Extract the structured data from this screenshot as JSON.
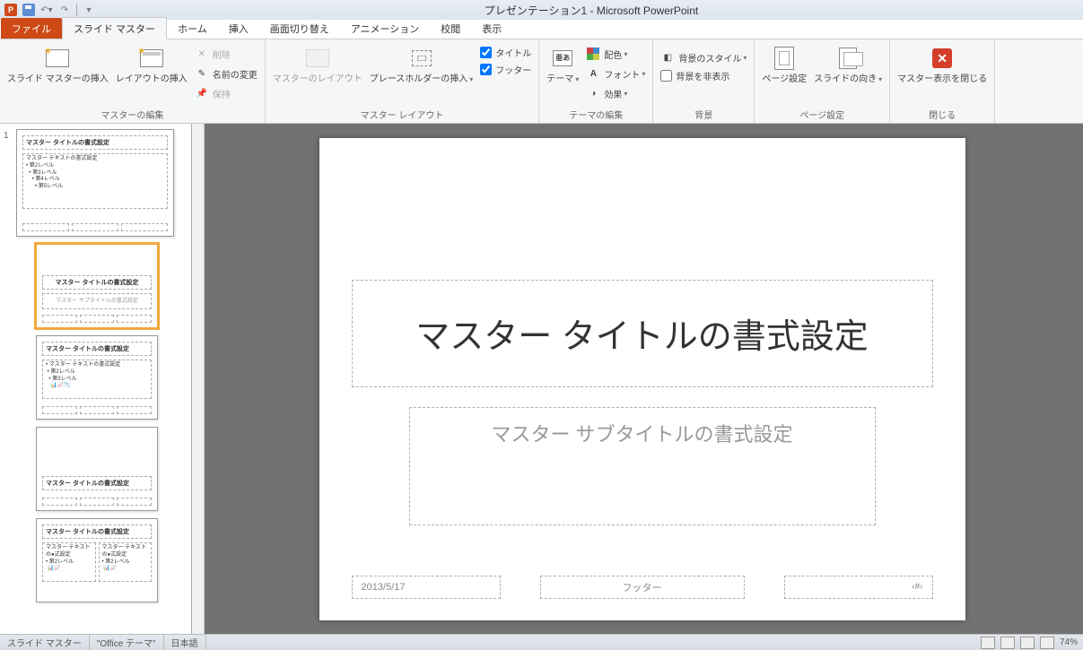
{
  "app": {
    "title": "プレゼンテーション1 - Microsoft PowerPoint"
  },
  "tabs": {
    "file": "ファイル",
    "items": [
      "スライド マスター",
      "ホーム",
      "挿入",
      "画面切り替え",
      "アニメーション",
      "校閲",
      "表示"
    ],
    "active_index": 0
  },
  "ribbon": {
    "group_edit_master": {
      "label": "マスターの編集",
      "insert_slide_master": "スライド マスターの挿入",
      "insert_layout": "レイアウトの挿入",
      "delete": "削除",
      "rename": "名前の変更",
      "preserve": "保持"
    },
    "group_master_layout": {
      "label": "マスター レイアウト",
      "master_layout": "マスターのレイアウト",
      "insert_placeholder": "プレースホルダーの挿入",
      "chk_title": "タイトル",
      "chk_footer": "フッター"
    },
    "group_theme": {
      "label": "テーマの編集",
      "theme": "テーマ",
      "colors": "配色",
      "fonts": "フォント",
      "effects": "効果"
    },
    "group_bg": {
      "label": "背景",
      "bg_style": "背景のスタイル",
      "hide_bg": "背景を非表示"
    },
    "group_page": {
      "label": "ページ設定",
      "page_setup": "ページ設定",
      "orientation": "スライドの向き"
    },
    "group_close": {
      "label": "閉じる",
      "close_master": "マスター表示を閉じる"
    }
  },
  "thumbnails": {
    "master_title": "マスター タイトルの書式設定",
    "master_body": "マスター テキストの書式設定",
    "layout_sub": "マスター サブタイトルの書式設定"
  },
  "slide": {
    "title_text": "マスター タイトルの書式設定",
    "subtitle_text": "マスター サブタイトルの書式設定",
    "date": "2013/5/17",
    "footer": "フッター",
    "number": "‹#›"
  },
  "status": {
    "mode": "スライド マスター",
    "theme": "\"Office テーマ\"",
    "lang": "日本語",
    "zoom": "74%"
  }
}
